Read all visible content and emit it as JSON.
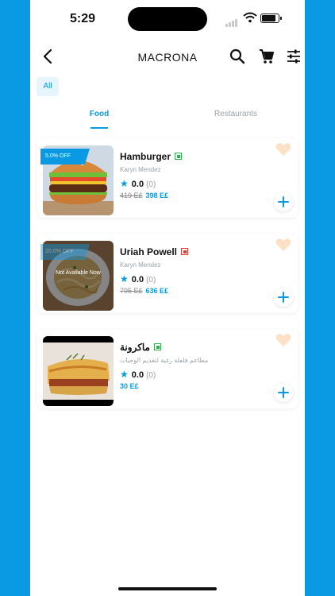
{
  "status_bar": {
    "time": "5:29"
  },
  "header": {
    "title": "MACRONA"
  },
  "filter": {
    "chip_label": "All"
  },
  "tabs": [
    {
      "label": "Food",
      "active": true
    },
    {
      "label": "Restaurants",
      "active": false
    }
  ],
  "items": [
    {
      "name": "Hamburger",
      "restaurant": "Karyn Mendez",
      "rating": "0.0",
      "rating_count": "(0)",
      "old_price": "419 E£",
      "price": "398 E£",
      "discount": "5.0% OFF",
      "veg_indicator": "green",
      "image": "burger"
    },
    {
      "name": "Uriah Powell",
      "restaurant": "Karyn Mendez",
      "rating": "0.0",
      "rating_count": "(0)",
      "old_price": "795 E£",
      "price": "636 E£",
      "discount": "20.0% OFF",
      "availability": "Not Available Now",
      "veg_indicator": "red",
      "image": "pasta"
    },
    {
      "name": "ماكرونة",
      "restaurant": "مطاعم فلفلة رغبة لتقديم الوجبات",
      "rating": "0.0",
      "rating_count": "(0)",
      "price": "30 E£",
      "veg_indicator": "green",
      "image": "baked-macaroni"
    }
  ],
  "colors": {
    "accent": "#0a9ae4",
    "heart": "#fbe1c7",
    "veg_green": "#2bb24c",
    "nonveg_red": "#e53935"
  }
}
